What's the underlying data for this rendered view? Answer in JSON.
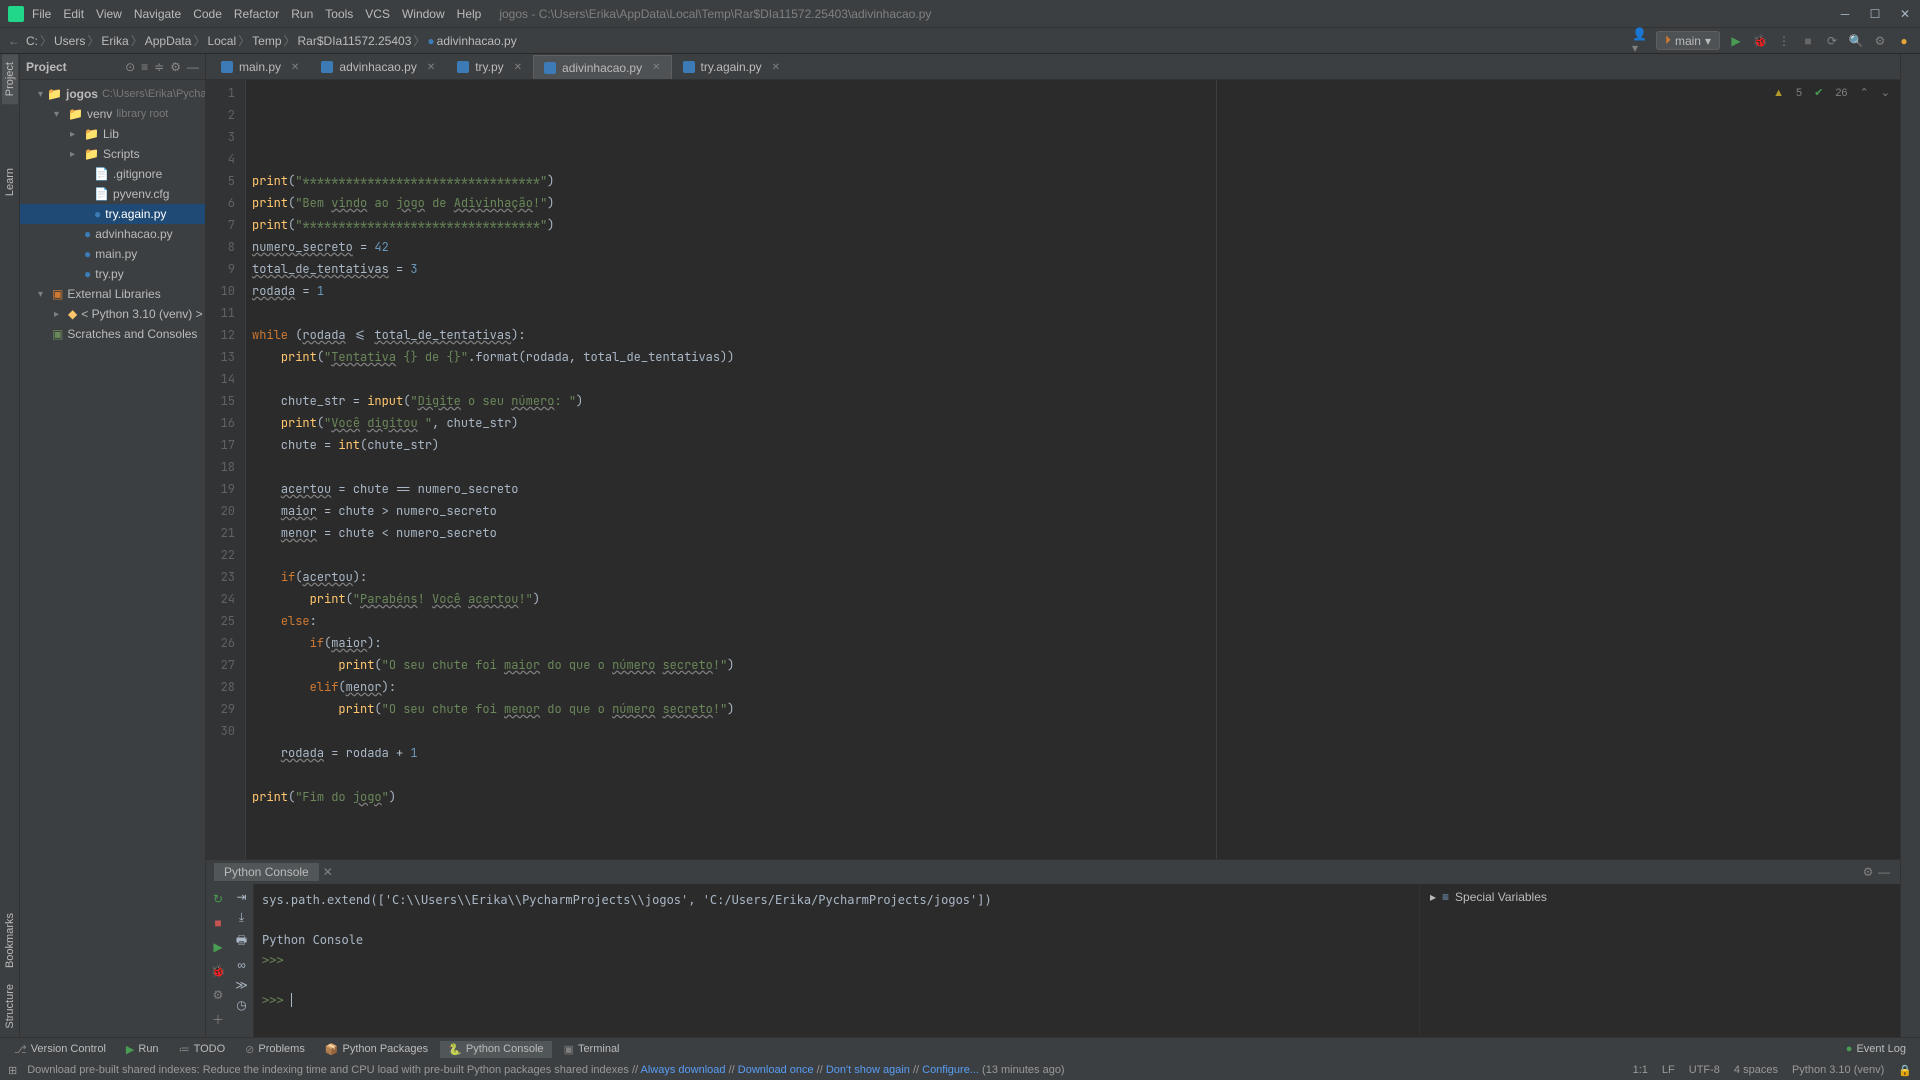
{
  "title": "jogos - C:\\Users\\Erika\\AppData\\Local\\Temp\\Rar$DIa11572.25403\\adivinhacao.py",
  "menu": [
    "File",
    "Edit",
    "View",
    "Navigate",
    "Code",
    "Refactor",
    "Run",
    "Tools",
    "VCS",
    "Window",
    "Help"
  ],
  "breadcrumbs": [
    "C:",
    "Users",
    "Erika",
    "AppData",
    "Local",
    "Temp",
    "Rar$DIa11572.25403",
    "adivinhacao.py"
  ],
  "branch": "main",
  "project_panel_title": "Project",
  "tree": {
    "root": "jogos",
    "root_note": "C:\\Users\\Erika\\Pycha",
    "venv": "venv",
    "venv_note": "library root",
    "lib": "Lib",
    "scripts": "Scripts",
    "gitignore": ".gitignore",
    "pyvenv": "pyvenv.cfg",
    "tryagain": "try.again.py",
    "adiv": "advinhacao.py",
    "mainpy": "main.py",
    "trypy": "try.py",
    "ext_lib": "External Libraries",
    "python": "< Python 3.10 (venv) >",
    "scratches": "Scratches and Consoles"
  },
  "tabs": [
    {
      "label": "main.py",
      "active": false
    },
    {
      "label": "advinhacao.py",
      "active": false
    },
    {
      "label": "try.py",
      "active": false
    },
    {
      "label": "adivinhacao.py",
      "active": true
    },
    {
      "label": "try.again.py",
      "active": false
    }
  ],
  "inspections": {
    "warnings": "5",
    "weak": "26"
  },
  "code_lines": [
    {
      "n": 1,
      "html": "<span class='fn'>print</span>(<span class='str'>\"*********************************\"</span>)"
    },
    {
      "n": 2,
      "html": "<span class='fn'>print</span>(<span class='str'>\"Bem </span><span class='str ud'>vindo</span><span class='str'> ao </span><span class='str ud'>jogo</span><span class='str'> de </span><span class='str ud'>Adivinhação</span><span class='str'>!\"</span>)"
    },
    {
      "n": 3,
      "html": "<span class='fn'>print</span>(<span class='str'>\"*********************************\"</span>)"
    },
    {
      "n": 4,
      "html": "<span class='ud'>numero_secreto</span> = <span class='num'>42</span>"
    },
    {
      "n": 5,
      "html": "<span class='ud'>total_de_tentativas</span> = <span class='num'>3</span>"
    },
    {
      "n": 6,
      "html": "<span class='ud'>rodada</span> = <span class='num'>1</span>"
    },
    {
      "n": 7,
      "html": ""
    },
    {
      "n": 8,
      "html": "<span class='kw'>while </span>(<span class='ud'>rodada</span> &lt;= <span class='ud'>total_de_tentativas</span>):"
    },
    {
      "n": 9,
      "html": "    <span class='fn'>print</span>(<span class='str'>\"</span><span class='str ud'>Tentativa</span><span class='str'> {} de {}\"</span>.format(rodada, total_de_tentativas))"
    },
    {
      "n": 10,
      "html": ""
    },
    {
      "n": 11,
      "html": "    chute_str = <span class='fn'>input</span>(<span class='str'>\"</span><span class='str ud'>Digite</span><span class='str'> o seu </span><span class='str ud'>número</span><span class='str'>: \"</span>)"
    },
    {
      "n": 12,
      "html": "    <span class='fn'>print</span>(<span class='str'>\"</span><span class='str ud'>Você</span><span class='str'> </span><span class='str ud'>digitou</span><span class='str'> \"</span>, chute_str)"
    },
    {
      "n": 13,
      "html": "    chute = <span class='fn'>int</span>(chute_str)"
    },
    {
      "n": 14,
      "html": ""
    },
    {
      "n": 15,
      "html": "    <span class='ud'>acertou</span> = chute == numero_secreto"
    },
    {
      "n": 16,
      "html": "    <span class='ud'>maior</span> = chute &gt; numero_secreto"
    },
    {
      "n": 17,
      "html": "    <span class='ud'>menor</span> = chute &lt; numero_secreto"
    },
    {
      "n": 18,
      "html": ""
    },
    {
      "n": 19,
      "html": "    <span class='kw'>if</span>(<span class='ud'>acertou</span>):"
    },
    {
      "n": 20,
      "html": "        <span class='fn'>print</span>(<span class='str'>\"</span><span class='str ud'>Parabéns</span><span class='str'>! </span><span class='str ud'>Você</span><span class='str'> </span><span class='str ud'>acertou</span><span class='str'>!\"</span>)"
    },
    {
      "n": 21,
      "html": "    <span class='kw'>else</span>:"
    },
    {
      "n": 22,
      "html": "        <span class='kw'>if</span>(<span class='ud'>maior</span>):"
    },
    {
      "n": 23,
      "html": "            <span class='fn'>print</span>(<span class='str'>\"O seu chute foi </span><span class='str ud'>maior</span><span class='str'> do que o </span><span class='str ud'>número</span><span class='str'> </span><span class='str ud'>secreto</span><span class='str'>!\"</span>)"
    },
    {
      "n": 24,
      "html": "        <span class='kw'>elif</span>(<span class='ud'>menor</span>):"
    },
    {
      "n": 25,
      "html": "            <span class='fn'>print</span>(<span class='str'>\"O seu chute foi </span><span class='str ud'>menor</span><span class='str'> do que o </span><span class='str ud'>número</span><span class='str'> </span><span class='str ud'>secreto</span><span class='str'>!\"</span>)"
    },
    {
      "n": 26,
      "html": ""
    },
    {
      "n": 27,
      "html": "    <span class='ud'>rodada</span> = rodada + <span class='num'>1</span>"
    },
    {
      "n": 28,
      "html": ""
    },
    {
      "n": 29,
      "html": "<span class='fn'>print</span>(<span class='str'>\"Fim do </span><span class='str ud'>jogo</span><span class='str'>\"</span>)"
    },
    {
      "n": 30,
      "html": ""
    }
  ],
  "console": {
    "tab": "Python Console",
    "line1": "sys.path.extend(['C:\\\\Users\\\\Erika\\\\PycharmProjects\\\\jogos', 'C:/Users/Erika/PycharmProjects/jogos'])",
    "line2": "Python Console",
    "prompt": ">>>",
    "special_vars": "Special Variables"
  },
  "tool_windows": {
    "version_control": "Version Control",
    "run": "Run",
    "todo": "TODO",
    "problems": "Problems",
    "packages": "Python Packages",
    "console": "Python Console",
    "terminal": "Terminal",
    "event_log": "Event Log"
  },
  "status": {
    "msg_prefix": "Download pre-built shared indexes: Reduce the indexing time and CPU load with pre-built Python packages shared indexes // ",
    "link1": "Always download",
    "sep": " // ",
    "link2": "Download once",
    "link3": "Don't show again",
    "link4": "Configure...",
    "suffix": " (13 minutes ago)",
    "pos": "1:1",
    "lf": "LF",
    "enc": "UTF-8",
    "indent": "4 spaces",
    "interp": "Python 3.10 (venv)"
  },
  "left_gutter": {
    "project": "Project",
    "bookmarks": "Bookmarks",
    "structure": "Structure",
    "learn": "Learn"
  }
}
